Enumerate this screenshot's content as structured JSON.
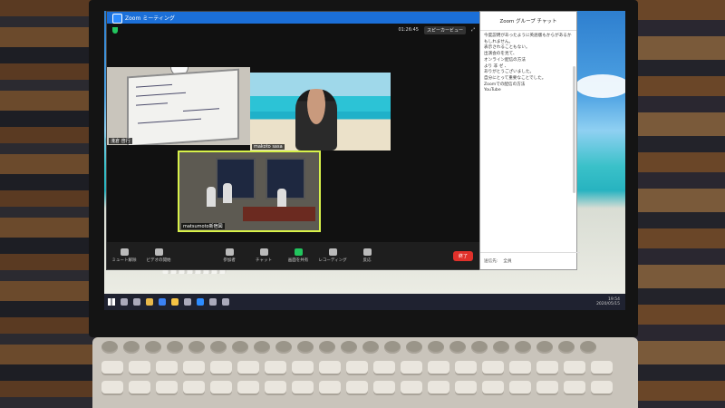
{
  "window": {
    "title": "Zoom ミーティング",
    "view_label": "スピーカービュー",
    "time": "01:26:45"
  },
  "participants": [
    {
      "name": "淺倉 啓行"
    },
    {
      "name": "makoto sasa"
    },
    {
      "name": "matsumoto新宿図"
    }
  ],
  "controls": [
    {
      "label": "ミュート解除",
      "icon": "mic-off-icon"
    },
    {
      "label": "ビデオの開始",
      "icon": "video-icon"
    },
    {
      "label": "参加者",
      "icon": "participants-icon"
    },
    {
      "label": "チャット",
      "icon": "chat-icon"
    },
    {
      "label": "画面を共有",
      "icon": "share-screen-icon"
    },
    {
      "label": "レコーディング",
      "icon": "record-icon"
    },
    {
      "label": "反応",
      "icon": "reaction-icon"
    }
  ],
  "end_label": "終了",
  "chat": {
    "title": "Zoom グループ チャット",
    "messages": [
      "今度説明があったように英語版もからがあるかもしれません。",
      "表示されることもない。",
      "出演会のを見て、",
      "オンライン配信の方法",
      "より 非 ゼ 、",
      "ありがとうございました。",
      "自分にとって重要なことでした。",
      "Zoomでの配信の方法",
      "YouTube"
    ],
    "footer_to": "送信先:",
    "footer_target": "全員"
  },
  "taskbar": {
    "time": "19:54",
    "date": "2020/05/15"
  }
}
